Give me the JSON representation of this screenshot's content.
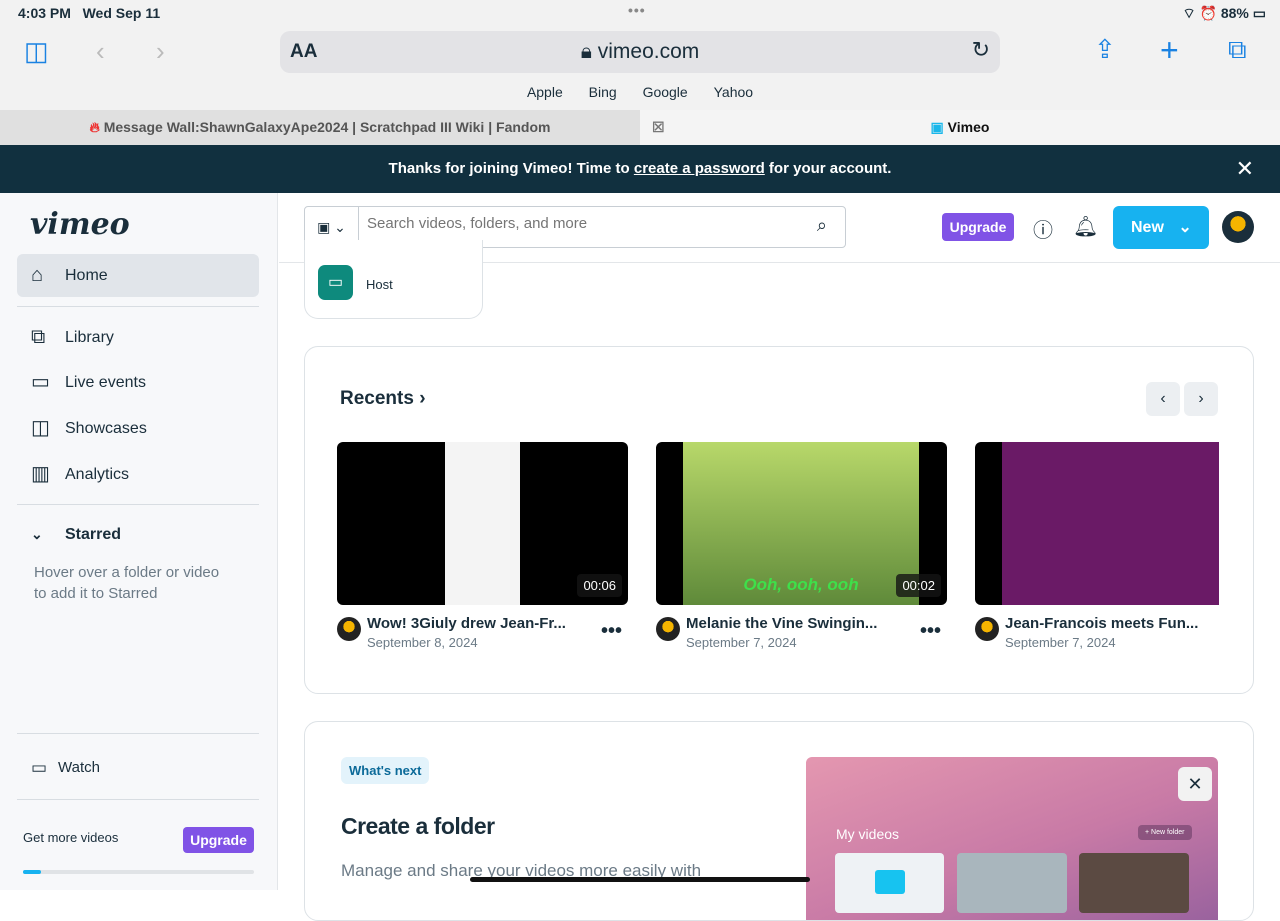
{
  "status": {
    "time": "4:03 PM",
    "date": "Wed Sep 11",
    "battery": "88%"
  },
  "browser": {
    "aa": "AA",
    "url": "vimeo.com",
    "favorites": [
      "Apple",
      "Bing",
      "Google",
      "Yahoo"
    ],
    "tabs": [
      {
        "label": "Message Wall:ShawnGalaxyApe2024 | Scratchpad III Wiki | Fandom"
      },
      {
        "label": "Vimeo"
      }
    ]
  },
  "banner": {
    "pre": "Thanks for joining Vimeo! Time to ",
    "link": "create a password",
    "post": " for your account."
  },
  "sidebar": {
    "logo": "vimeo",
    "items": [
      "Home",
      "Library",
      "Live events",
      "Showcases",
      "Analytics"
    ],
    "starred": "Starred",
    "hint1": "Hover over a folder or video",
    "hint2": "to add it to Starred",
    "watch": "Watch",
    "get_more": "Get more videos",
    "upgrade": "Upgrade",
    "usage_percent": 8
  },
  "header": {
    "search_placeholder": "Search videos, folders, and more",
    "upgrade": "Upgrade",
    "new": "New"
  },
  "host": "Host",
  "recents": {
    "title": "Recents",
    "videos": [
      {
        "title": "Wow! 3Giuly drew Jean-Fr...",
        "date": "September 8, 2024",
        "duration": "00:06"
      },
      {
        "title": "Melanie the Vine Swingin...",
        "date": "September 7, 2024",
        "duration": "00:02",
        "caption": "Ooh, ooh, ooh"
      },
      {
        "title": "Jean-Francois meets Fun...",
        "date": "September 7, 2024"
      }
    ]
  },
  "whats_next": {
    "badge": "What's next",
    "title": "Create a folder",
    "desc": "Manage and share your videos more easily with",
    "preview_title": "My videos",
    "new_folder": "+ New folder"
  }
}
